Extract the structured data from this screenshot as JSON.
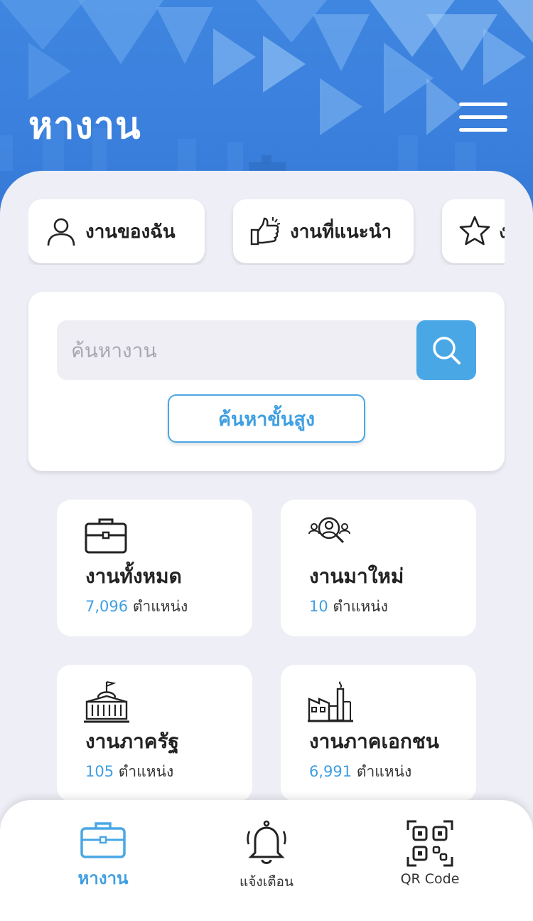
{
  "header": {
    "title": "หางาน",
    "menu_icon": "hamburger-menu-icon",
    "colors": {
      "primary": "#3a7fdc",
      "accent": "#4aa7e6"
    }
  },
  "quick_links": [
    {
      "label": "งานของฉัน",
      "icon": "user-icon"
    },
    {
      "label": "งานที่แนะนำ",
      "icon": "thumbs-up-icon"
    },
    {
      "label": "ง",
      "icon": "star-icon"
    }
  ],
  "search": {
    "placeholder": "ค้นหางาน",
    "button_icon": "search-icon",
    "advanced_label": "ค้นหาขั้นสูง"
  },
  "categories": [
    {
      "name": "งานทั้งหมด",
      "count": "7,096",
      "unit": "ตำแหน่ง",
      "icon": "briefcase-icon"
    },
    {
      "name": "งานมาใหม่",
      "count": "10",
      "unit": "ตำแหน่ง",
      "icon": "people-search-icon"
    },
    {
      "name": "งานภาครัฐ",
      "count": "105",
      "unit": "ตำแหน่ง",
      "icon": "government-building-icon"
    },
    {
      "name": "งานภาคเอกชน",
      "count": "6,991",
      "unit": "ตำแหน่ง",
      "icon": "factory-icon"
    }
  ],
  "bottom_nav": [
    {
      "label": "หางาน",
      "icon": "briefcase-icon",
      "active": true
    },
    {
      "label": "แจ้งเตือน",
      "icon": "bell-icon",
      "active": false
    },
    {
      "label": "QR Code",
      "icon": "qr-code-icon",
      "active": false
    }
  ]
}
